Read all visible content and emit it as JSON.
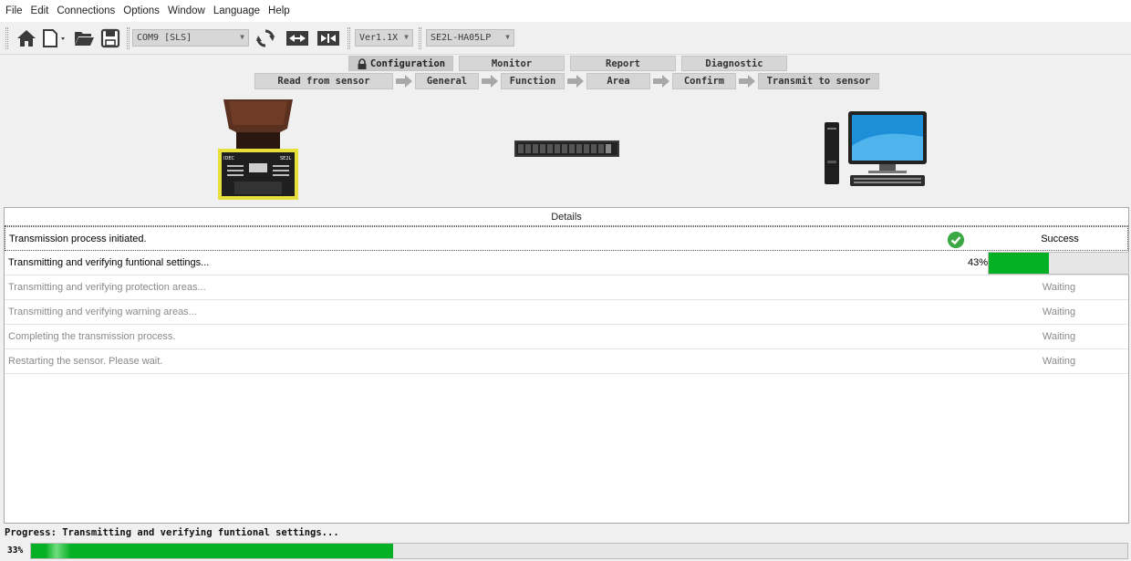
{
  "menu": [
    "File",
    "Edit",
    "Connections",
    "Options",
    "Window",
    "Language",
    "Help"
  ],
  "toolbar": {
    "port": "COM9 [SLS]",
    "version": "Ver1.1X",
    "model": "SE2L-HA05LP"
  },
  "tabs": [
    {
      "label": "Configuration",
      "active": true,
      "icon": "lock-icon"
    },
    {
      "label": "Monitor",
      "active": false
    },
    {
      "label": "Report",
      "active": false
    },
    {
      "label": "Diagnostic",
      "active": false
    }
  ],
  "steps": [
    "Read from sensor",
    "General",
    "Function",
    "Area",
    "Confirm",
    "Transmit to sensor"
  ],
  "device": {
    "brand": "IDEC",
    "model_short": "SE2L"
  },
  "details": {
    "header": "Details",
    "rows": [
      {
        "text": "Transmission process initiated.",
        "status": "Success"
      },
      {
        "text": "Transmitting and verifying funtional settings...",
        "percent": "43%",
        "progress": 0.43
      },
      {
        "text": "Transmitting and verifying protection areas...",
        "status": "Waiting"
      },
      {
        "text": "Transmitting and verifying warning areas...",
        "status": "Waiting"
      },
      {
        "text": "Completing the transmission process.",
        "status": "Waiting"
      },
      {
        "text": "Restarting the sensor. Please wait.",
        "status": "Waiting"
      }
    ]
  },
  "status": {
    "label": "Progress: Transmitting and verifying funtional settings...",
    "percent": "33%",
    "progress": 0.33
  },
  "colors": {
    "progress_green": "#06b025",
    "success_green": "#3aa845",
    "sensor_yellow": "#e8e03a",
    "sensor_head": "#5a3020"
  }
}
